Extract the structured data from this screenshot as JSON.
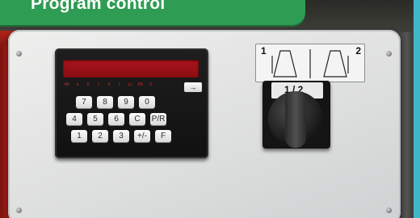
{
  "banner": {
    "title": "Program control"
  },
  "keypad": {
    "brand": "",
    "indicators": [
      "AP",
      "a",
      "b",
      "c",
      "d",
      "L",
      "Lc",
      "PE",
      "F"
    ],
    "arrow_label": "→",
    "rows": [
      [
        "7",
        "8",
        "9",
        "0"
      ],
      [
        "4",
        "5",
        "6",
        "C",
        "P/R"
      ],
      [
        "1",
        "2",
        "3",
        "+/-",
        "F"
      ]
    ]
  },
  "sign_plate": {
    "left_number": "1",
    "right_number": "2"
  },
  "rotary_switch": {
    "label": "1 / 2"
  },
  "colors": {
    "banner": "#2f9c53",
    "display": "#a8141a",
    "panel": "#e3e4e4",
    "rail": "#c42318",
    "accent_strip": "#3fb7c9"
  }
}
